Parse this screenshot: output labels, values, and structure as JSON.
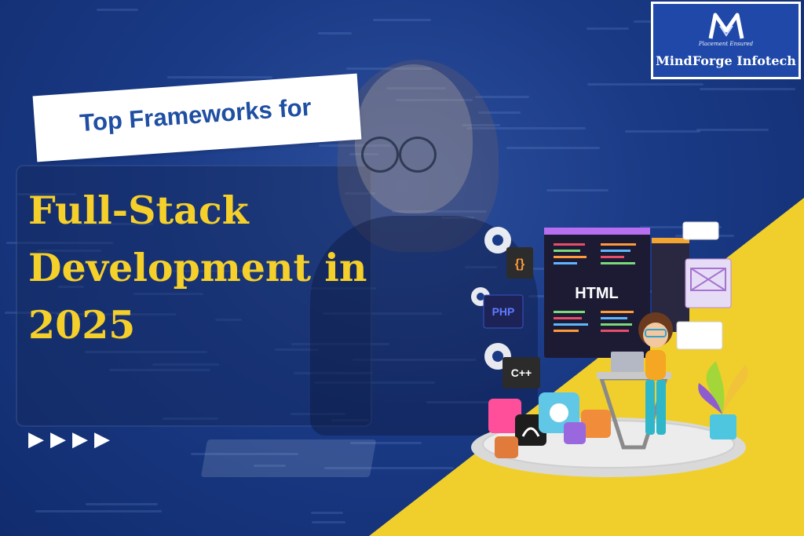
{
  "subtitle": "Top Frameworks for",
  "title_lines": [
    "Full-Stack",
    "Development in",
    "2025"
  ],
  "arrow_glyph": "▶",
  "logo": {
    "tagline": "Placement Ensured",
    "name": "MindForge Infotech"
  },
  "illustration": {
    "html_label": "HTML",
    "php_label": "PHP",
    "cpp_label": "C++",
    "braces_label": "{}"
  },
  "colors": {
    "background": "#1a3a86",
    "accent_yellow": "#f0cf2c",
    "title": "#f5d02a",
    "subtitle": "#1f4fa3",
    "logo_bg": "#1f48a8"
  }
}
